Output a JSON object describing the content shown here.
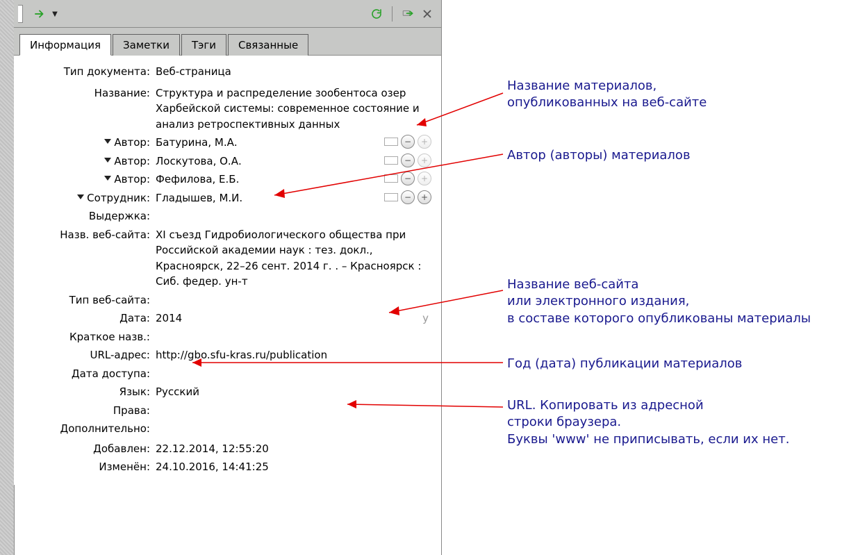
{
  "toolbar": {
    "icons": {
      "go": "go-arrow-icon",
      "go_menu": "go-dropdown-icon",
      "refresh": "refresh-icon",
      "export": "export-icon",
      "close": "close-icon"
    }
  },
  "tabs": {
    "info": "Информация",
    "notes": "Заметки",
    "tags": "Тэги",
    "related": "Связанные"
  },
  "fields": {
    "item_type": {
      "label": "Тип документа:",
      "value": "Веб-страница"
    },
    "title": {
      "label": "Название:",
      "value": "Структура и распределение зообентоса озер Харбейской системы: современное состояние и анализ ретроспективных данных"
    },
    "authors": [
      {
        "label": "Автор:",
        "value": "Батурина, М.А."
      },
      {
        "label": "Автор:",
        "value": "Лоскутова, О.А."
      },
      {
        "label": "Автор:",
        "value": "Фефилова, Е.Б."
      }
    ],
    "contributor": {
      "label": "Сотрудник:",
      "value": "Гладышев, М.И."
    },
    "abstract": {
      "label": "Выдержка:",
      "value": ""
    },
    "website_title": {
      "label": "Назв. веб-сайта:",
      "value": "XI съезд Гидробиологического общества при Российской академии наук : тез. докл., Красноярск, 22–26 сент. 2014 г. . – Красноярск : Сиб. федер. ун-т"
    },
    "website_type": {
      "label": "Тип веб-сайта:",
      "value": ""
    },
    "date": {
      "label": "Дата:",
      "value": "2014",
      "suffix": "y"
    },
    "short_title": {
      "label": "Краткое назв.:",
      "value": ""
    },
    "url": {
      "label": "URL-адрес:",
      "value": "http://gbo.sfu-kras.ru/publication"
    },
    "access_date": {
      "label": "Дата доступа:",
      "value": ""
    },
    "language": {
      "label": "Язык:",
      "value": "Русский"
    },
    "rights": {
      "label": "Права:",
      "value": ""
    },
    "extra": {
      "label": "Дополнительно:",
      "value": ""
    },
    "date_added": {
      "label": "Добавлен:",
      "value": "22.12.2014, 12:55:20"
    },
    "date_modified": {
      "label": "Изменён:",
      "value": "24.10.2016, 14:41:25"
    }
  },
  "annotations": {
    "a1": "Название материалов,\nопубликованных на веб-сайте",
    "a2": "Автор (авторы) материалов",
    "a3": "Название веб-сайта\nили электронного издания,\nв составе которого опубликованы материалы",
    "a4": "Год (дата) публикации материалов",
    "a5": "URL. Копировать из адресной\nстроки браузера.\nБуквы 'www' не приписывать, если их нет."
  }
}
